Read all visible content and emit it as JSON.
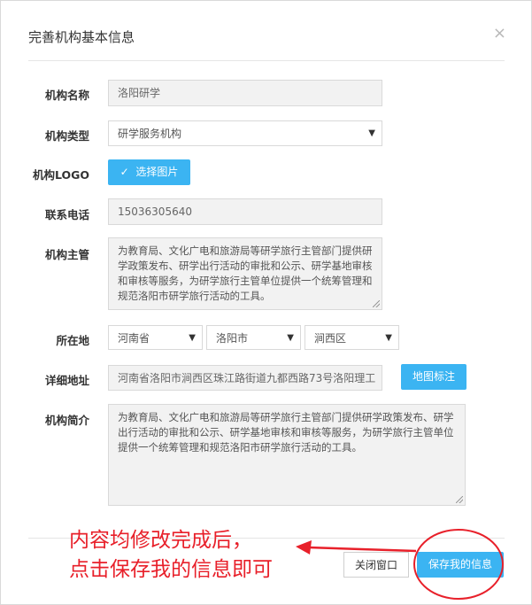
{
  "dialog": {
    "title": "完善机构基本信息",
    "close_symbol": "×"
  },
  "form": {
    "name_label": "机构名称",
    "name_value": "洛阳研学",
    "type_label": "机构类型",
    "type_value": "研学服务机构",
    "logo_label": "机构LOGO",
    "logo_button": "选择图片",
    "phone_label": "联系电话",
    "phone_value": "15036305640",
    "supervisor_label": "机构主管",
    "supervisor_value": "为教育局、文化广电和旅游局等研学旅行主管部门提供研学政策发布、研学出行活动的审批和公示、研学基地审核和审核等服务，为研学旅行主管单位提供一个统筹管理和规范洛阳市研学旅行活动的工具。",
    "location_label": "所在地",
    "province": "河南省",
    "city": "洛阳市",
    "district": "涧西区",
    "address_label": "详细地址",
    "address_value": "河南省洛阳市涧西区珠江路街道九都西路73号洛阳理工",
    "map_button": "地图标注",
    "intro_label": "机构简介",
    "intro_value": "为教育局、文化广电和旅游局等研学旅行主管部门提供研学政策发布、研学出行活动的审批和公示、研学基地审核和审核等服务，为研学旅行主管单位提供一个统筹管理和规范洛阳市研学旅行活动的工具。"
  },
  "footer": {
    "close_button": "关闭窗口",
    "save_button": "保存我的信息"
  },
  "annotation": {
    "line1": "内容均修改完成后，",
    "line2": "点击保存我的信息即可",
    "color": "#e8202a"
  },
  "colors": {
    "accent": "#3bb4f2"
  }
}
